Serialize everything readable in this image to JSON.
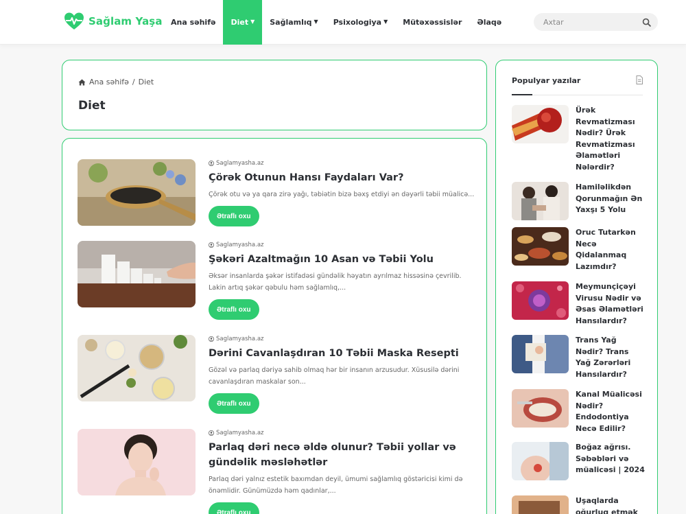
{
  "header": {
    "logo": "Sağlam Yaşa",
    "nav": [
      {
        "label": "Ana səhifə",
        "dropdown": false,
        "active": false
      },
      {
        "label": "Diet",
        "dropdown": true,
        "active": true
      },
      {
        "label": "Sağlamlıq",
        "dropdown": true,
        "active": false
      },
      {
        "label": "Psixologiya",
        "dropdown": true,
        "active": false
      },
      {
        "label": "Mütəxəssislər",
        "dropdown": false,
        "active": false
      },
      {
        "label": "Əlaqə",
        "dropdown": false,
        "active": false
      }
    ],
    "search_placeholder": "Axtar"
  },
  "breadcrumb": {
    "home": "Ana səhifə",
    "separator": "/",
    "current": "Diet"
  },
  "page_title": "Diet",
  "posts": [
    {
      "author": "Saglamyasha.az",
      "title": "Çörək Otunun Hansı Faydaları Var?",
      "excerpt": "Çörək otu və ya qara zirə yağı, təbiətin bizə bəxş etdiyi ən dəyərli təbii müalicə...",
      "button": "Ətraflı oxu"
    },
    {
      "author": "Saglamyasha.az",
      "title": "Şəkəri Azaltmağın 10 Asan və Təbii Yolu",
      "excerpt": "Əksər insanlarda şəkər istifadəsi gündəlik həyatın ayrılmaz hissəsinə çevrilib. Lakin artıq şəkər qəbulu həm sağlamlıq,...",
      "button": "Ətraflı oxu"
    },
    {
      "author": "Saglamyasha.az",
      "title": "Dərini Cavanlaşdıran 10 Təbii Maska Resepti",
      "excerpt": "Gözəl və parlaq dəriyə sahib olmaq hər bir insanın arzusudur. Xüsusilə dərini cavanlaşdıran maskalar son...",
      "button": "Ətraflı oxu"
    },
    {
      "author": "Saglamyasha.az",
      "title": "Parlaq dəri necə əldə olunur? Təbii yollar və gündəlik məsləhətlər",
      "excerpt": "Parlaq dəri yalnız estetik baxımdan deyil, ümumi sağlamlıq göstəricisi kimi də önəmlidir. Günümüzdə həm qadınlar,...",
      "button": "Ətraflı oxu"
    }
  ],
  "sidebar": {
    "title": "Populyar yazılar",
    "items": [
      {
        "title": "Ürək Revmatizması Nədir? Ürək Revmatizması Əlamətləri Nələrdir?"
      },
      {
        "title": "Hamiləlikdən Qorunmağın Ən Yaxşı 5 Yolu"
      },
      {
        "title": "Oruc Tutarkən Necə Qidalanmaq Lazımdır?"
      },
      {
        "title": "Meymunçiçəyi Virusu Nədir və Əsas Əlamətləri Hansılardır?"
      },
      {
        "title": "Trans Yağ Nədir? Trans Yağ Zərərləri Hansılardır?"
      },
      {
        "title": "Kanal Müalicəsi Nədir? Endodontiya Necə Edilir?"
      },
      {
        "title": "Boğaz ağrısı. Səbəbləri və müalicəsi | 2024"
      },
      {
        "title": "Uşaqlarda oğurluq etmək"
      }
    ]
  },
  "colors": {
    "accent": "#2fcc71",
    "text": "#2c2f34",
    "muted": "#666666"
  },
  "icons": [
    "heart-pulse-logo-icon",
    "chevron-down-icon",
    "search-icon",
    "home-icon",
    "user-icon",
    "document-icon"
  ]
}
